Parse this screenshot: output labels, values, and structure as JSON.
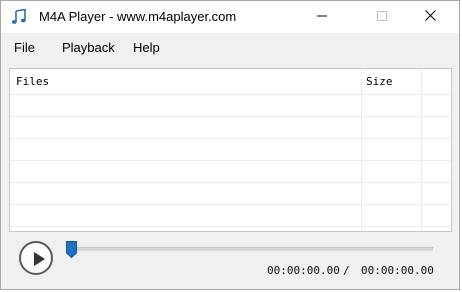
{
  "window": {
    "title": "M4A Player - www.m4aplayer.com"
  },
  "titlebar_icons": {
    "app": "music-note-icon",
    "minimize": "minimize-icon",
    "maximize": "maximize-icon",
    "close": "close-icon"
  },
  "menu": {
    "items": [
      {
        "label": "File"
      },
      {
        "label": "Playback"
      },
      {
        "label": "Help"
      }
    ]
  },
  "file_list": {
    "columns": [
      {
        "label": "Files"
      },
      {
        "label": "Size"
      }
    ],
    "rows": []
  },
  "player": {
    "play_icon": "play-icon",
    "progress_fraction": 0.0,
    "current_time": "00:00:00.00",
    "separator": "/",
    "total_time": "00:00:00.00"
  },
  "colors": {
    "accent": "#1f6fc3",
    "window_bg": "#f0f0f0"
  }
}
